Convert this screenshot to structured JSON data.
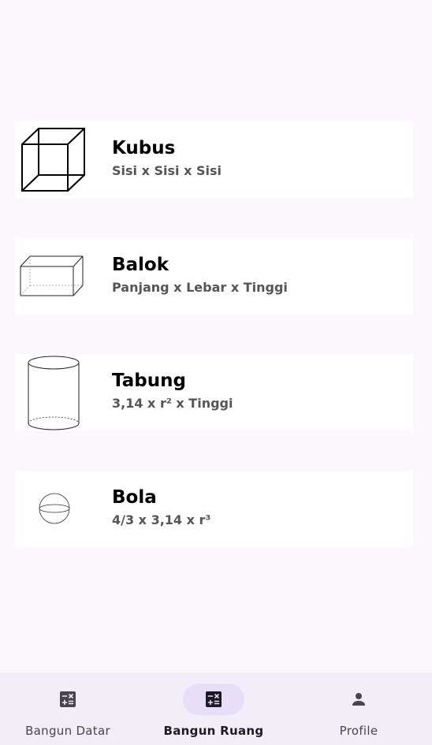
{
  "shapes": [
    {
      "title": "Kubus",
      "formula": "Sisi x Sisi x Sisi",
      "icon": "cube-icon"
    },
    {
      "title": "Balok",
      "formula": "Panjang x Lebar x Tinggi",
      "icon": "cuboid-icon"
    },
    {
      "title": "Tabung",
      "formula": "3,14 x r² x Tinggi",
      "icon": "cylinder-icon"
    },
    {
      "title": "Bola",
      "formula": "4/3 x 3,14 x  r³",
      "icon": "sphere-icon"
    }
  ],
  "nav": {
    "items": [
      {
        "label": "Bangun Datar",
        "icon": "calculator-icon",
        "active": false
      },
      {
        "label": "Bangun Ruang",
        "icon": "calculator-icon",
        "active": true
      },
      {
        "label": "Profile",
        "icon": "person-icon",
        "active": false
      }
    ]
  },
  "colors": {
    "background": "#fcf7fc",
    "card": "#ffffff",
    "nav_background": "#f3edf7",
    "nav_active_indicator": "#e8def8",
    "formula_text": "#555555"
  }
}
